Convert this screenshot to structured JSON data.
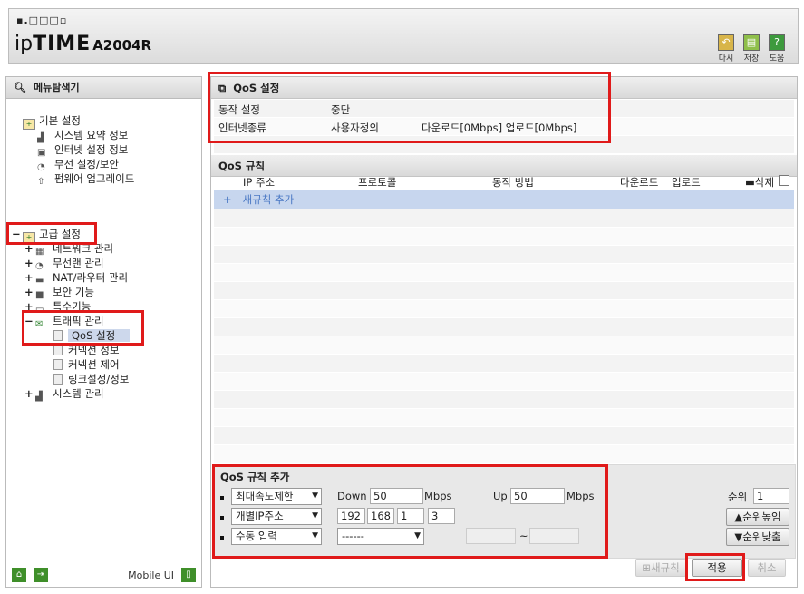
{
  "header": {
    "logo_dots": "▪.□□□▫",
    "brand_ip": "ip",
    "brand_time": "TIME",
    "model": "A2004R",
    "buttons": [
      {
        "label": "다시",
        "icon": "undo-icon"
      },
      {
        "label": "저장",
        "icon": "save-icon"
      },
      {
        "label": "도움",
        "icon": "help-icon"
      }
    ]
  },
  "sidebar": {
    "title": "메뉴탐색기",
    "basic": {
      "label": "기본 설정",
      "items": [
        "시스템 요약 정보",
        "인터넷 설정 정보",
        "무선 설정/보안",
        "펌웨어 업그레이드"
      ]
    },
    "advanced": {
      "label": "고급 설정",
      "items": [
        "네트워크 관리",
        "무선랜 관리",
        "NAT/라우터 관리",
        "보안 기능",
        "특수기능"
      ]
    },
    "traffic": {
      "label": "트래픽 관리",
      "items": [
        "QoS 설정",
        "커넥션 정보",
        "커넥션 제어",
        "링크설정/정보"
      ]
    },
    "system": "시스템 관리",
    "mobile_ui": "Mobile UI"
  },
  "qos_settings": {
    "title": "QoS 설정",
    "mode_label": "동작 설정",
    "mode_value": "중단",
    "type_label": "인터넷종류",
    "type_value": "사용자정의",
    "speed_value": "다운로드[0Mbps] 업로드[0Mbps]"
  },
  "qos_rules": {
    "title": "QoS 규칙",
    "columns": {
      "ip": "IP 주소",
      "protocol": "프로토콜",
      "action": "동작 방법",
      "download": "다운로드",
      "upload": "업로드",
      "delete": "삭제"
    },
    "add_rule": "새규칙 추가"
  },
  "qos_add": {
    "title": "QoS 규칙 추가",
    "rate_mode": "최대속도제한",
    "down_label": "Down",
    "down_value": "50",
    "up_label": "Up",
    "up_value": "50",
    "unit": "Mbps",
    "order_label": "순위",
    "order_value": "1",
    "ip_mode": "개별IP주소",
    "ip": [
      "192",
      "168",
      "1",
      "3"
    ],
    "proto_mode": "수동 입력",
    "proto_select": "------",
    "range_sep": "~",
    "order_up": "순위높임",
    "order_down": "순위낮춤"
  },
  "footer_buttons": {
    "new_rule": "새규칙",
    "apply": "적용",
    "cancel": "취소"
  },
  "colors": {
    "highlight": "#e01a1a",
    "selected": "#cdd8ec",
    "add_row": "#c7d6ee",
    "link": "#4a78c4"
  }
}
